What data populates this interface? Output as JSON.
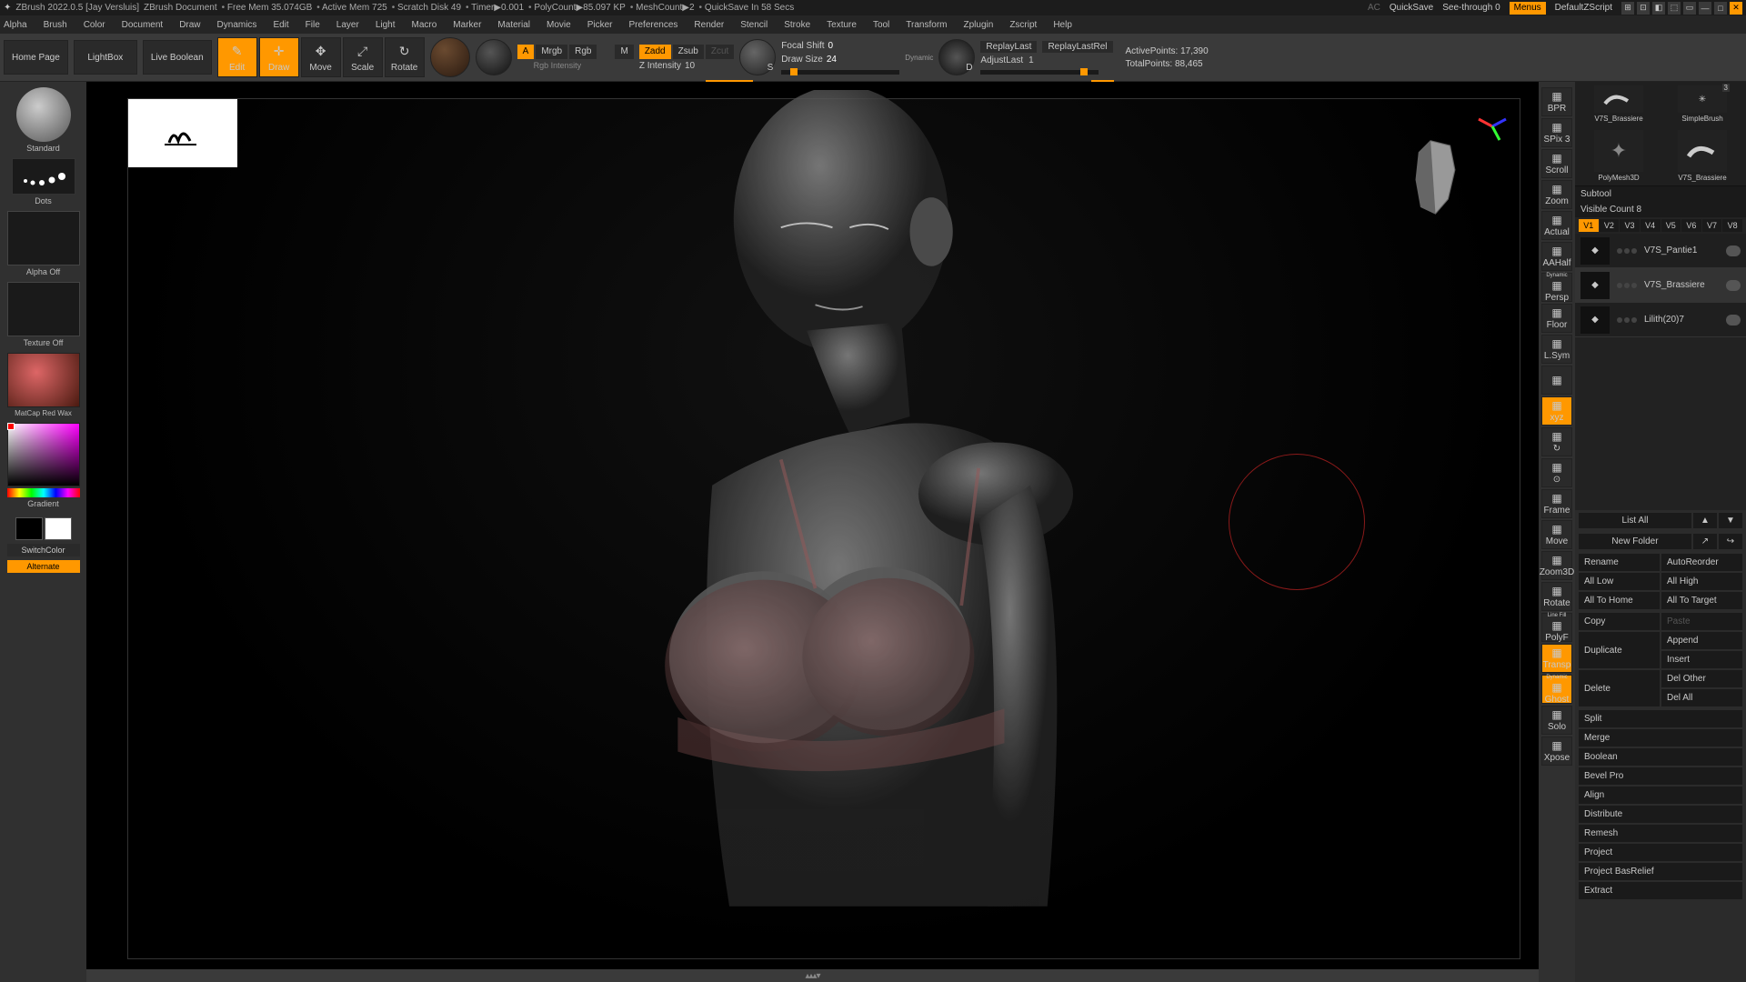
{
  "titlebar": {
    "app": "ZBrush 2022.0.5 [Jay Versluis]",
    "doc": "ZBrush Document",
    "freemem": "Free Mem 35.074GB",
    "activemem": "Active Mem 725",
    "scratch": "Scratch Disk 49",
    "timer": "Timer▶0.001",
    "polycount": "PolyCount▶85.097 KP",
    "meshcount": "MeshCount▶2",
    "quicksave": "QuickSave In 58 Secs",
    "ac": "AC",
    "quicksave_btn": "QuickSave",
    "seethrough": "See-through",
    "seethrough_val": "0",
    "menus": "Menus",
    "defaultzscript": "DefaultZScript"
  },
  "menu": [
    "Alpha",
    "Brush",
    "Color",
    "Document",
    "Draw",
    "Dynamics",
    "Edit",
    "File",
    "Layer",
    "Light",
    "Macro",
    "Marker",
    "Material",
    "Movie",
    "Picker",
    "Preferences",
    "Render",
    "Stencil",
    "Stroke",
    "Texture",
    "Tool",
    "Transform",
    "Zplugin",
    "Zscript",
    "Help"
  ],
  "nav": {
    "home": "Home Page",
    "lightbox": "LightBox",
    "liveboolean": "Live Boolean"
  },
  "modes": [
    {
      "label": "Edit",
      "active": true
    },
    {
      "label": "Draw",
      "active": true
    },
    {
      "label": "Move",
      "active": false
    },
    {
      "label": "Scale",
      "active": false
    },
    {
      "label": "Rotate",
      "active": false
    }
  ],
  "rgb_group": {
    "A": "A",
    "mrgb": "Mrgb",
    "rgb": "Rgb",
    "m": "M",
    "sub": "Rgb Intensity"
  },
  "z_group": {
    "zadd": "Zadd",
    "zsub": "Zsub",
    "zcut": "Zcut",
    "zintensity_lbl": "Z Intensity",
    "zintensity_val": "10"
  },
  "brush": {
    "focal_lbl": "Focal Shift",
    "focal_val": "0",
    "draw_lbl": "Draw Size",
    "draw_val": "24",
    "dynamic": "Dynamic",
    "s": "S",
    "d": "D"
  },
  "replay": {
    "replaylast": "ReplayLast",
    "replaylastrel": "ReplayLastRel",
    "adjust_lbl": "AdjustLast",
    "adjust_val": "1"
  },
  "stats": {
    "active_lbl": "ActivePoints:",
    "active_val": "17,390",
    "total_lbl": "TotalPoints:",
    "total_val": "88,465"
  },
  "left": {
    "brush_name": "Standard",
    "stroke": "Dots",
    "alpha": "Alpha Off",
    "texture": "Texture Off",
    "material": "MatCap Red Wax",
    "gradient": "Gradient",
    "switchcolor": "SwitchColor",
    "alternate": "Alternate"
  },
  "rbar": [
    {
      "l": "BPR"
    },
    {
      "l": "SPix 3"
    },
    {
      "l": "Scroll"
    },
    {
      "l": "Zoom"
    },
    {
      "l": "Actual"
    },
    {
      "l": "AAHalf"
    },
    {
      "l": "Persp",
      "sub": "Dynamic"
    },
    {
      "l": "Floor"
    },
    {
      "l": "L.Sym"
    },
    {
      "l": ""
    },
    {
      "l": "xyz",
      "active": true
    },
    {
      "l": "↻"
    },
    {
      "l": "⊙"
    },
    {
      "l": "Frame"
    },
    {
      "l": "Move"
    },
    {
      "l": "Zoom3D"
    },
    {
      "l": "Rotate"
    },
    {
      "l": "PolyF",
      "sub": "Line Fill"
    },
    {
      "l": "Transp",
      "active": true
    },
    {
      "l": "Ghost",
      "active": true,
      "sub": "Dynamic"
    },
    {
      "l": "Solo"
    },
    {
      "l": "Xpose"
    }
  ],
  "tools": {
    "slot1_name": "PolyMesh3D",
    "slot2_name": "V7S_Brassiere",
    "top1": "V7S_Brassiere",
    "top2": "SimpleBrush",
    "top2_badge": "3"
  },
  "subtool": {
    "header": "Subtool",
    "visible_lbl": "Visible Count",
    "visible_val": "8",
    "tabs": [
      "V1",
      "V2",
      "V3",
      "V4",
      "V5",
      "V6",
      "V7",
      "V8"
    ],
    "items": [
      {
        "name": "V7S_Pantie1",
        "active": false
      },
      {
        "name": "V7S_Brassiere",
        "active": true
      },
      {
        "name": "Lilith(20)7",
        "active": false
      }
    ]
  },
  "listrow": {
    "listall": "List All",
    "newfolder": "New Folder"
  },
  "actions_pairs": [
    [
      "Rename",
      "AutoReorder"
    ],
    [
      "All Low",
      "All High"
    ],
    [
      "All To Home",
      "All To Target"
    ]
  ],
  "copy": "Copy",
  "paste": "Paste",
  "duplicate": "Duplicate",
  "append": "Append",
  "insert": "Insert",
  "delete": "Delete",
  "delother": "Del Other",
  "delall": "Del All",
  "singles": [
    "Split",
    "Merge",
    "Boolean",
    "Bevel Pro",
    "Align",
    "Distribute",
    "Remesh",
    "Project",
    "Project BasRelief",
    "Extract"
  ]
}
